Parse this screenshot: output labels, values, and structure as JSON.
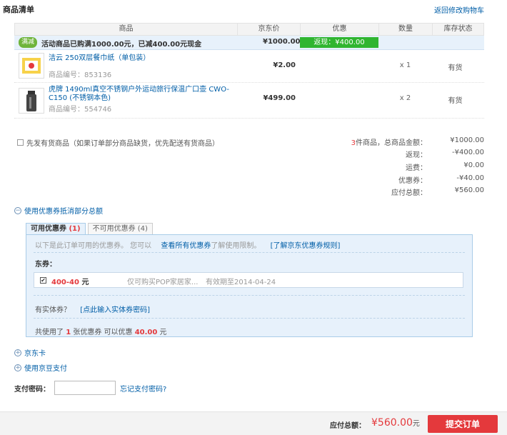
{
  "section": {
    "title": "商品清单",
    "back_link": "返回修改购物车"
  },
  "table": {
    "headers": [
      "商品",
      "京东价",
      "优惠",
      "数量",
      "库存状态"
    ],
    "promo": {
      "badge": "满减",
      "text": "活动商品已购满1000.00元，已减400.00元现金",
      "total": "¥1000.00",
      "cashback": "返现：¥400.00"
    },
    "items": [
      {
        "name": "洁云 250双层餐巾纸（单包装）",
        "code": "商品编号：853136",
        "price": "¥2.00",
        "qty": "x 1",
        "stock": "有货"
      },
      {
        "name": "虎牌 1490ml真空不锈钢户外运动旅行保温广口壶 CWO-C150 (不锈钢本色)",
        "code": "商品编号：554746",
        "price": "¥499.00",
        "qty": "x 2",
        "stock": "有货"
      }
    ]
  },
  "prefer_stock": "先发有货商品（如果订单部分商品缺货，优先配送有货商品）",
  "summary": {
    "count": "3",
    "count_label": "件商品，总商品金额：",
    "total": "¥1000.00",
    "cashback_label": "返现：",
    "cashback": "-¥400.00",
    "shipping_label": "运费：",
    "shipping": "¥0.00",
    "coupon_label": "优惠券：",
    "coupon": "-¥40.00",
    "payable_label": "应付总额：",
    "payable": "¥560.00"
  },
  "coupon": {
    "toggle": "使用优惠券抵消部分总额",
    "tab_available": "可用优惠券",
    "tab_available_count": "(1)",
    "tab_unavailable": "不可用优惠券",
    "tab_unavailable_count": "(4)",
    "note": "以下是此订单可用的优惠券。 您可以",
    "view_all": "查看所有优惠券",
    "note_tail": "了解使用限制。",
    "rules_link": "[了解京东优惠券规则]",
    "group": "东券：",
    "item": {
      "amount": "400-40",
      "unit": "元",
      "scope": "仅可购买POP家居家...",
      "expiry": "有效期至2014-04-24"
    },
    "physical_label": "有实体券？",
    "physical_link": "[点此输入实体券密码]",
    "used_prefix": "共使用了",
    "used_count": "1",
    "used_mid": "张优惠券  可以优惠",
    "used_amount": "40.00",
    "used_unit": "元"
  },
  "jd_card": "京东卡",
  "jd_bean": "使用京豆支付",
  "password": {
    "label": "支付密码：",
    "value": "",
    "forgot": "忘记支付密码?"
  },
  "footer": {
    "pay_label": "应付总额：",
    "pay_amount": "¥560.00",
    "pay_unit": "元",
    "submit": "提交订单"
  },
  "colors": {
    "accent": "#e4393c",
    "link": "#005ea7",
    "promo_bg": "#e7f1fb",
    "cash_green": "#30b530"
  }
}
